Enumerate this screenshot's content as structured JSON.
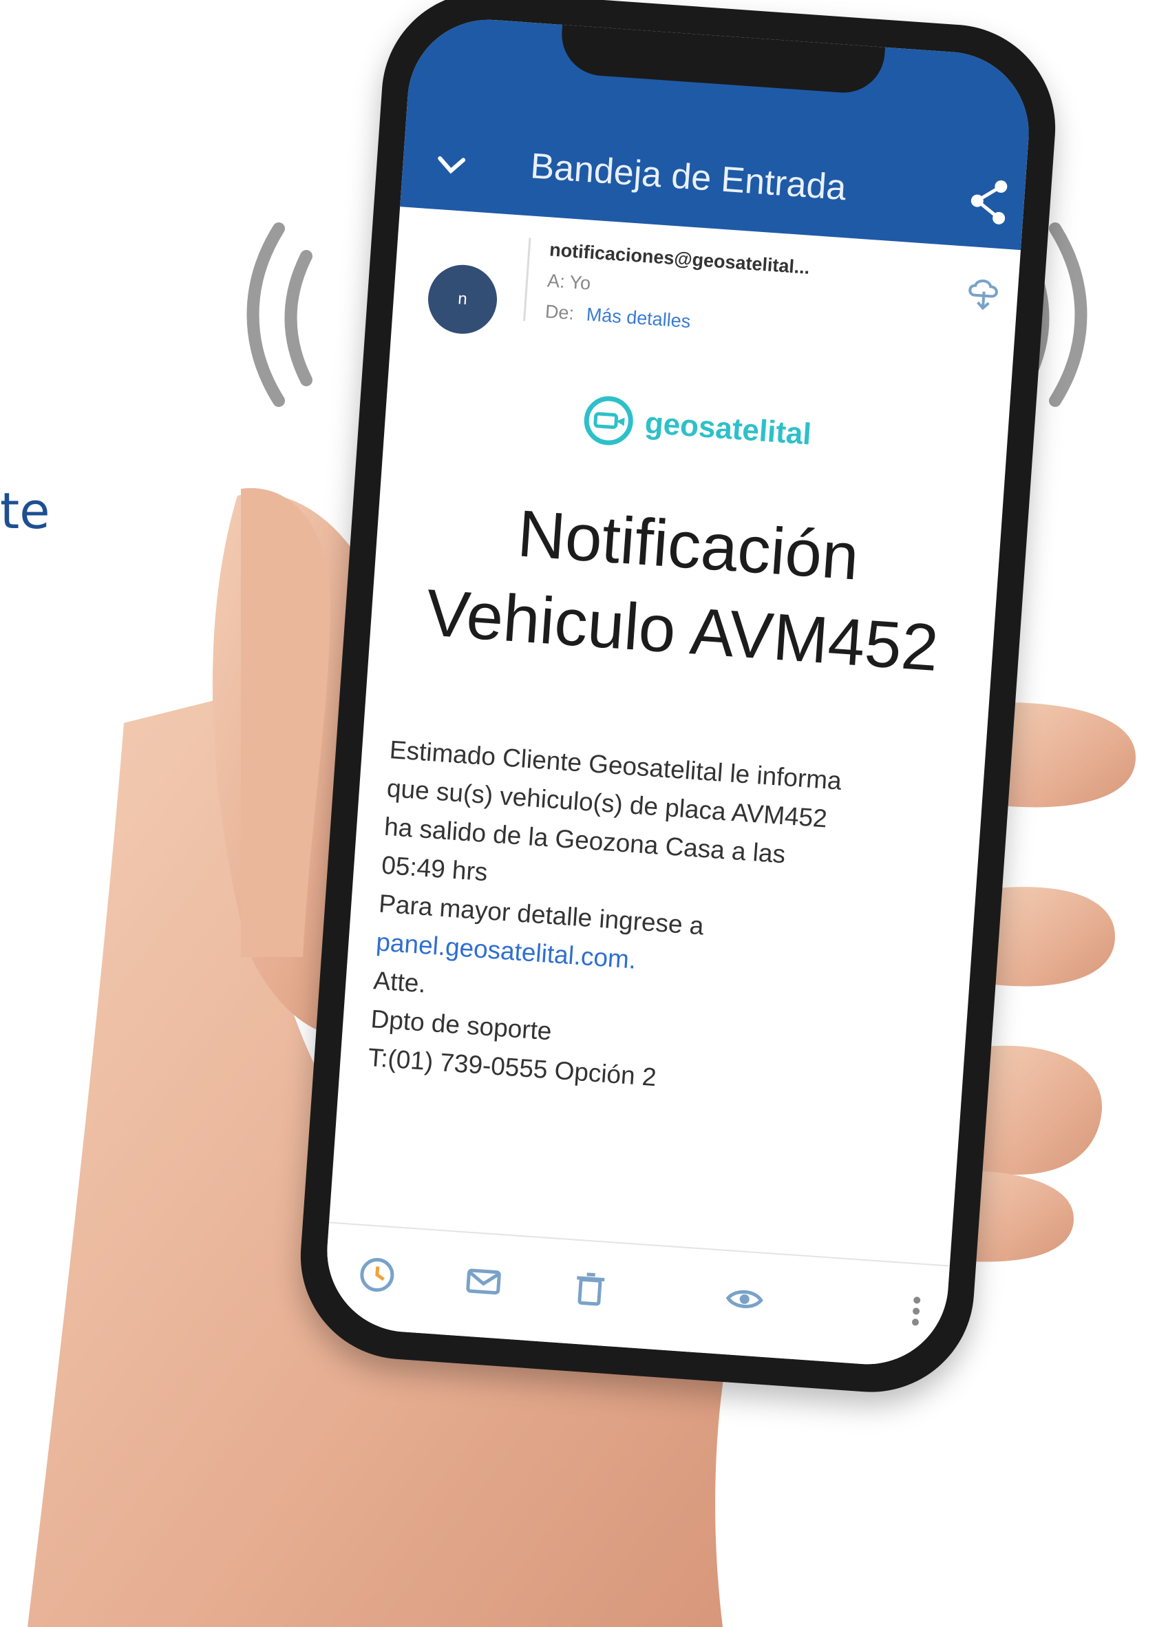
{
  "page": {
    "fragment_text": "te"
  },
  "email_app": {
    "title": "Bandeja de Entrada",
    "from": "notificaciones@geosatelital...",
    "to": "A: Yo",
    "cc_label": "De:",
    "cc_link": "Más detalles",
    "avatar_initial": "n",
    "brand": "geosatelital",
    "headline_line1": "Notificación",
    "headline_line2": "Vehiculo AVM452",
    "body_line1": "Estimado Cliente Geosatelital le informa",
    "body_line2": "que su(s) vehiculo(s) de placa AVM452",
    "body_line3": "ha salido de la Geozona Casa a las",
    "body_line4": "05:49 hrs",
    "body_line5": "Para mayor detalle ingrese a",
    "body_link": "panel.geosatelital.com.",
    "body_line6": "Atte.",
    "body_line7": "Dpto de soporte",
    "body_line8": "T:(01) 739-0555 Opción 2"
  },
  "colors": {
    "app_bar": "#1f5aa6",
    "brand": "#2ec0c9",
    "link": "#2f6fcf",
    "fragment": "#1d4f91"
  },
  "icons": [
    "chevron-down-icon",
    "share-icon",
    "cloud-download-icon",
    "clock-icon",
    "envelope-icon",
    "trash-icon",
    "eye-icon",
    "more-vertical-icon",
    "vibration-icon"
  ]
}
